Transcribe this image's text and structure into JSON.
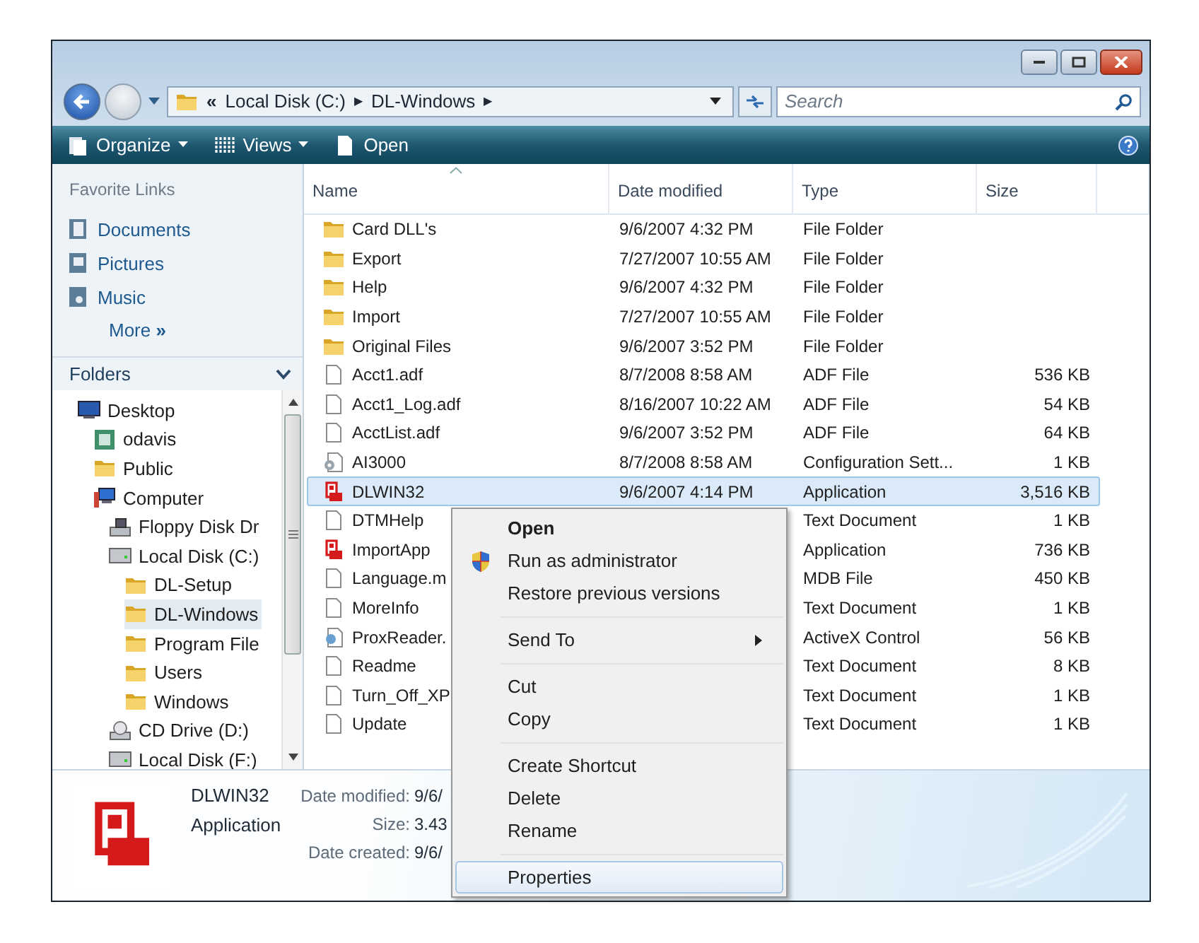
{
  "address": {
    "overflow": "«",
    "parts": [
      {
        "label": "Local Disk (C:)",
        "arrow": "▶"
      },
      {
        "label": "DL-Windows",
        "arrow": "▶"
      }
    ]
  },
  "search": {
    "placeholder": "Search"
  },
  "toolbar": {
    "buttons": [
      {
        "label": "Organize",
        "kind": "organize",
        "dropdown": true
      },
      {
        "label": "Views",
        "kind": "views",
        "dropdown": true
      },
      {
        "label": "Open",
        "kind": "open",
        "dropdown": false
      }
    ]
  },
  "favorites": {
    "title": "Favorite Links",
    "items": [
      {
        "label": "Documents",
        "kind": "documents"
      },
      {
        "label": "Pictures",
        "kind": "pictures"
      },
      {
        "label": "Music",
        "kind": "music"
      }
    ],
    "more": {
      "label": "More",
      "chevron": "»"
    }
  },
  "folders": {
    "title": "Folders",
    "tree": [
      {
        "label": "Desktop",
        "kind": "desktop",
        "selected": false,
        "children": [
          {
            "label": "odavis",
            "kind": "user",
            "selected": false
          },
          {
            "label": "Public",
            "kind": "folder",
            "selected": false
          },
          {
            "label": "Computer",
            "kind": "computer",
            "selected": false,
            "children": [
              {
                "label": "Floppy Disk Dr",
                "kind": "floppy",
                "selected": false
              },
              {
                "label": "Local Disk (C:)",
                "kind": "drive",
                "selected": false,
                "children": [
                  {
                    "label": "DL-Setup",
                    "kind": "folder",
                    "selected": false
                  },
                  {
                    "label": "DL-Windows",
                    "kind": "folder",
                    "selected": true
                  },
                  {
                    "label": "Program File",
                    "kind": "folder",
                    "selected": false
                  },
                  {
                    "label": "Users",
                    "kind": "folder",
                    "selected": false
                  },
                  {
                    "label": "Windows",
                    "kind": "folder",
                    "selected": false
                  }
                ]
              },
              {
                "label": "CD Drive (D:)",
                "kind": "cd",
                "selected": false
              },
              {
                "label": "Local Disk (F:)",
                "kind": "drive",
                "selected": false
              }
            ]
          }
        ]
      }
    ]
  },
  "table": {
    "columns": [
      {
        "label": "Name",
        "sorted": true
      },
      {
        "label": "Date modified",
        "sorted": false
      },
      {
        "label": "Type",
        "sorted": false
      },
      {
        "label": "Size",
        "sorted": false
      }
    ],
    "rows": [
      {
        "name": "Card DLL's",
        "date": "9/6/2007 4:32 PM",
        "type": "File Folder",
        "kind": "folder",
        "selected": false
      },
      {
        "name": "Export",
        "date": "7/27/2007 10:55 AM",
        "type": "File Folder",
        "kind": "folder",
        "selected": false
      },
      {
        "name": "Help",
        "date": "9/6/2007 4:32 PM",
        "type": "File Folder",
        "kind": "folder",
        "selected": false
      },
      {
        "name": "Import",
        "date": "7/27/2007 10:55 AM",
        "type": "File Folder",
        "kind": "folder",
        "selected": false
      },
      {
        "name": "Original Files",
        "date": "9/6/2007 3:52 PM",
        "type": "File Folder",
        "kind": "folder",
        "selected": false
      },
      {
        "name": "Acct1.adf",
        "date": "8/7/2008 8:58 AM",
        "type": "ADF File",
        "size": "536 KB",
        "kind": "doc",
        "selected": false
      },
      {
        "name": "Acct1_Log.adf",
        "date": "8/16/2007 10:22 AM",
        "type": "ADF File",
        "size": "54 KB",
        "kind": "doc",
        "selected": false
      },
      {
        "name": "AcctList.adf",
        "date": "9/6/2007 3:52 PM",
        "type": "ADF File",
        "size": "64 KB",
        "kind": "doc",
        "selected": false
      },
      {
        "name": "AI3000",
        "date": "8/7/2008 8:58 AM",
        "type": "Configuration Sett...",
        "size": "1 KB",
        "kind": "config",
        "selected": false
      },
      {
        "name": "DLWIN32",
        "date": "9/6/2007 4:14 PM",
        "type": "Application",
        "size": "3,516 KB",
        "kind": "app",
        "selected": true
      },
      {
        "name": "DTMHelp",
        "type": "Text Document",
        "size": "1 KB",
        "kind": "doc",
        "selected": false
      },
      {
        "name": "ImportApp",
        "type": "Application",
        "size": "736 KB",
        "kind": "app",
        "selected": false
      },
      {
        "name": "Language.m",
        "type": "MDB File",
        "size": "450 KB",
        "kind": "doc",
        "selected": false
      },
      {
        "name": "MoreInfo",
        "type": "Text Document",
        "size": "1 KB",
        "kind": "doc",
        "selected": false
      },
      {
        "name": "ProxReader.",
        "type": "ActiveX Control",
        "size": "56 KB",
        "kind": "activex",
        "selected": false
      },
      {
        "name": "Readme",
        "type": "Text Document",
        "size": "8 KB",
        "kind": "doc",
        "selected": false
      },
      {
        "name": "Turn_Off_XP",
        "type": "Text Document",
        "size": "1 KB",
        "kind": "doc",
        "selected": false
      },
      {
        "name": "Update",
        "type": "Text Document",
        "size": "1 KB",
        "kind": "doc",
        "selected": false
      }
    ]
  },
  "details": {
    "name": "DLWIN32",
    "type": "Application",
    "fields": [
      {
        "label": "Date modified:",
        "value": "9/6/"
      },
      {
        "label": "Size:",
        "value": "3.43"
      },
      {
        "label": "Date created:",
        "value": "9/6/"
      }
    ]
  },
  "context_menu": {
    "groups": [
      [
        {
          "label": "Open",
          "default": true,
          "shield": false,
          "submenu": false,
          "selected": false
        },
        {
          "label": "Run as administrator",
          "default": false,
          "shield": true,
          "submenu": false,
          "selected": false
        },
        {
          "label": "Restore previous versions",
          "default": false,
          "shield": false,
          "submenu": false,
          "selected": false
        }
      ],
      [
        {
          "label": "Send To",
          "default": false,
          "shield": false,
          "submenu": true,
          "selected": false
        }
      ],
      [
        {
          "label": "Cut",
          "default": false,
          "shield": false,
          "submenu": false,
          "selected": false
        },
        {
          "label": "Copy",
          "default": false,
          "shield": false,
          "submenu": false,
          "selected": false
        }
      ],
      [
        {
          "label": "Create Shortcut",
          "default": false,
          "shield": false,
          "submenu": false,
          "selected": false
        },
        {
          "label": "Delete",
          "default": false,
          "shield": false,
          "submenu": false,
          "selected": false
        },
        {
          "label": "Rename",
          "default": false,
          "shield": false,
          "submenu": false,
          "selected": false
        }
      ],
      [
        {
          "label": "Properties",
          "default": false,
          "shield": false,
          "submenu": false,
          "selected": true
        }
      ]
    ]
  }
}
